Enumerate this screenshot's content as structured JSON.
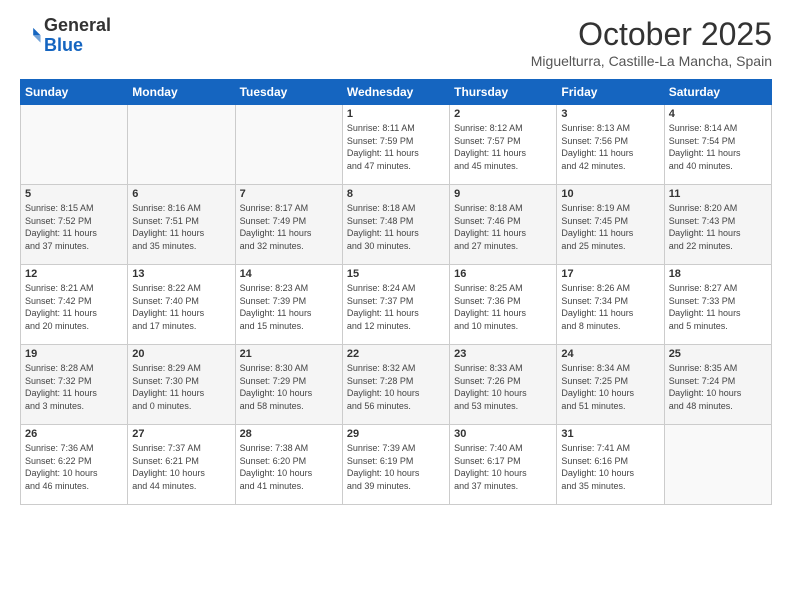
{
  "logo": {
    "general": "General",
    "blue": "Blue"
  },
  "title": "October 2025",
  "location": "Miguelturra, Castille-La Mancha, Spain",
  "headers": [
    "Sunday",
    "Monday",
    "Tuesday",
    "Wednesday",
    "Thursday",
    "Friday",
    "Saturday"
  ],
  "weeks": [
    [
      {
        "day": "",
        "info": ""
      },
      {
        "day": "",
        "info": ""
      },
      {
        "day": "",
        "info": ""
      },
      {
        "day": "1",
        "info": "Sunrise: 8:11 AM\nSunset: 7:59 PM\nDaylight: 11 hours\nand 47 minutes."
      },
      {
        "day": "2",
        "info": "Sunrise: 8:12 AM\nSunset: 7:57 PM\nDaylight: 11 hours\nand 45 minutes."
      },
      {
        "day": "3",
        "info": "Sunrise: 8:13 AM\nSunset: 7:56 PM\nDaylight: 11 hours\nand 42 minutes."
      },
      {
        "day": "4",
        "info": "Sunrise: 8:14 AM\nSunset: 7:54 PM\nDaylight: 11 hours\nand 40 minutes."
      }
    ],
    [
      {
        "day": "5",
        "info": "Sunrise: 8:15 AM\nSunset: 7:52 PM\nDaylight: 11 hours\nand 37 minutes."
      },
      {
        "day": "6",
        "info": "Sunrise: 8:16 AM\nSunset: 7:51 PM\nDaylight: 11 hours\nand 35 minutes."
      },
      {
        "day": "7",
        "info": "Sunrise: 8:17 AM\nSunset: 7:49 PM\nDaylight: 11 hours\nand 32 minutes."
      },
      {
        "day": "8",
        "info": "Sunrise: 8:18 AM\nSunset: 7:48 PM\nDaylight: 11 hours\nand 30 minutes."
      },
      {
        "day": "9",
        "info": "Sunrise: 8:18 AM\nSunset: 7:46 PM\nDaylight: 11 hours\nand 27 minutes."
      },
      {
        "day": "10",
        "info": "Sunrise: 8:19 AM\nSunset: 7:45 PM\nDaylight: 11 hours\nand 25 minutes."
      },
      {
        "day": "11",
        "info": "Sunrise: 8:20 AM\nSunset: 7:43 PM\nDaylight: 11 hours\nand 22 minutes."
      }
    ],
    [
      {
        "day": "12",
        "info": "Sunrise: 8:21 AM\nSunset: 7:42 PM\nDaylight: 11 hours\nand 20 minutes."
      },
      {
        "day": "13",
        "info": "Sunrise: 8:22 AM\nSunset: 7:40 PM\nDaylight: 11 hours\nand 17 minutes."
      },
      {
        "day": "14",
        "info": "Sunrise: 8:23 AM\nSunset: 7:39 PM\nDaylight: 11 hours\nand 15 minutes."
      },
      {
        "day": "15",
        "info": "Sunrise: 8:24 AM\nSunset: 7:37 PM\nDaylight: 11 hours\nand 12 minutes."
      },
      {
        "day": "16",
        "info": "Sunrise: 8:25 AM\nSunset: 7:36 PM\nDaylight: 11 hours\nand 10 minutes."
      },
      {
        "day": "17",
        "info": "Sunrise: 8:26 AM\nSunset: 7:34 PM\nDaylight: 11 hours\nand 8 minutes."
      },
      {
        "day": "18",
        "info": "Sunrise: 8:27 AM\nSunset: 7:33 PM\nDaylight: 11 hours\nand 5 minutes."
      }
    ],
    [
      {
        "day": "19",
        "info": "Sunrise: 8:28 AM\nSunset: 7:32 PM\nDaylight: 11 hours\nand 3 minutes."
      },
      {
        "day": "20",
        "info": "Sunrise: 8:29 AM\nSunset: 7:30 PM\nDaylight: 11 hours\nand 0 minutes."
      },
      {
        "day": "21",
        "info": "Sunrise: 8:30 AM\nSunset: 7:29 PM\nDaylight: 10 hours\nand 58 minutes."
      },
      {
        "day": "22",
        "info": "Sunrise: 8:32 AM\nSunset: 7:28 PM\nDaylight: 10 hours\nand 56 minutes."
      },
      {
        "day": "23",
        "info": "Sunrise: 8:33 AM\nSunset: 7:26 PM\nDaylight: 10 hours\nand 53 minutes."
      },
      {
        "day": "24",
        "info": "Sunrise: 8:34 AM\nSunset: 7:25 PM\nDaylight: 10 hours\nand 51 minutes."
      },
      {
        "day": "25",
        "info": "Sunrise: 8:35 AM\nSunset: 7:24 PM\nDaylight: 10 hours\nand 48 minutes."
      }
    ],
    [
      {
        "day": "26",
        "info": "Sunrise: 7:36 AM\nSunset: 6:22 PM\nDaylight: 10 hours\nand 46 minutes."
      },
      {
        "day": "27",
        "info": "Sunrise: 7:37 AM\nSunset: 6:21 PM\nDaylight: 10 hours\nand 44 minutes."
      },
      {
        "day": "28",
        "info": "Sunrise: 7:38 AM\nSunset: 6:20 PM\nDaylight: 10 hours\nand 41 minutes."
      },
      {
        "day": "29",
        "info": "Sunrise: 7:39 AM\nSunset: 6:19 PM\nDaylight: 10 hours\nand 39 minutes."
      },
      {
        "day": "30",
        "info": "Sunrise: 7:40 AM\nSunset: 6:17 PM\nDaylight: 10 hours\nand 37 minutes."
      },
      {
        "day": "31",
        "info": "Sunrise: 7:41 AM\nSunset: 6:16 PM\nDaylight: 10 hours\nand 35 minutes."
      },
      {
        "day": "",
        "info": ""
      }
    ]
  ]
}
